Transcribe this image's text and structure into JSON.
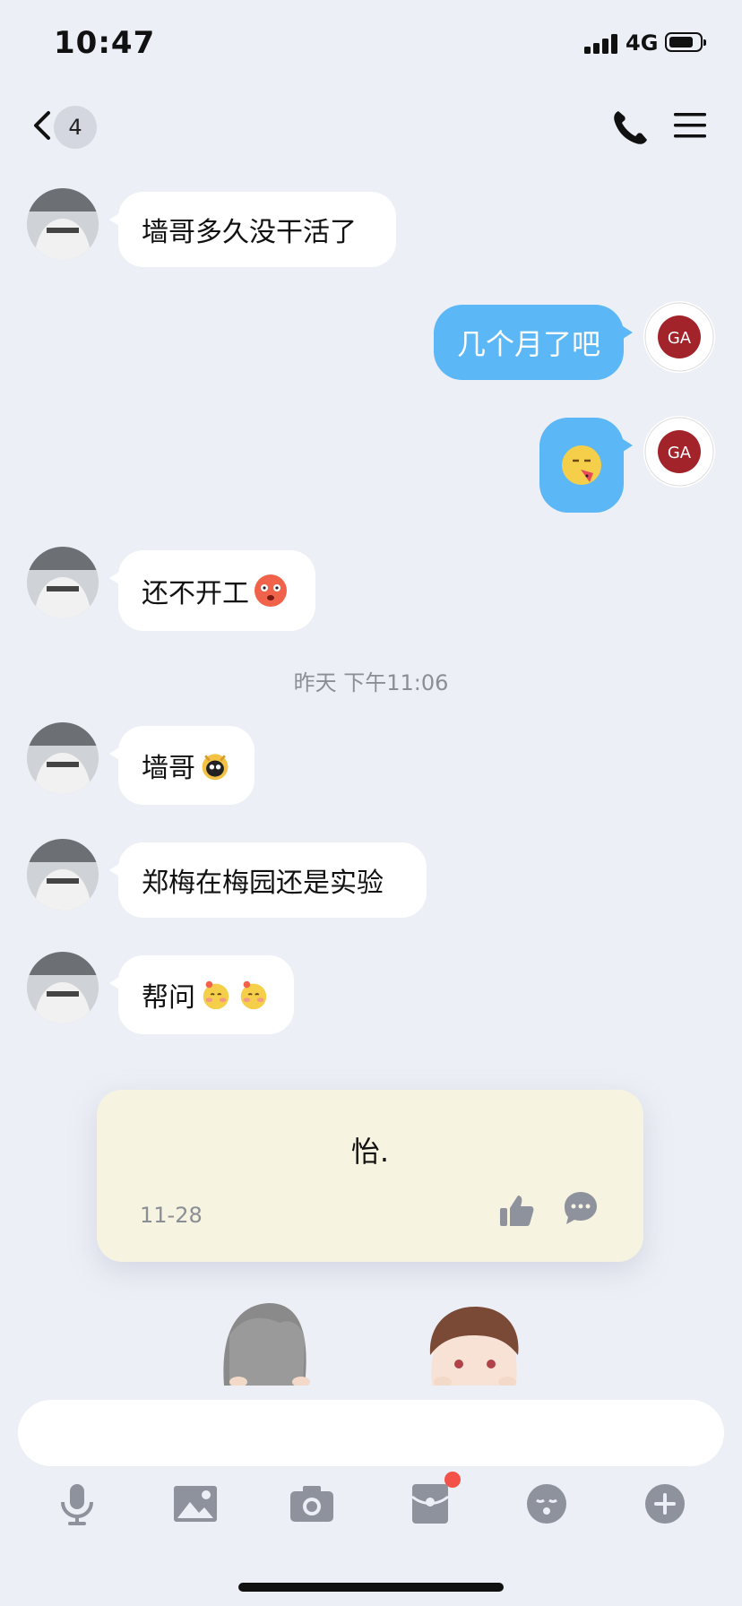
{
  "status_bar": {
    "time": "10:47",
    "network": "4G",
    "battery_fraction": 0.8
  },
  "nav": {
    "unread_badge": "4",
    "icons": [
      "back-chevron-icon",
      "phone-icon",
      "menu-icon"
    ]
  },
  "messages": [
    {
      "side": "in",
      "text": "墙哥多久没干活了",
      "emoji": []
    },
    {
      "side": "out",
      "text": "几个月了吧",
      "emoji": []
    },
    {
      "side": "out",
      "text": "",
      "emoji": [
        "eating-watermelon-emoji"
      ]
    },
    {
      "side": "in",
      "text": "还不开工",
      "emoji": [
        "angry-face-emoji"
      ]
    },
    {
      "side": "in",
      "text": "墙哥",
      "emoji": [
        "penguin-emoji"
      ]
    },
    {
      "side": "in",
      "text": "郑梅在梅园还是实验",
      "emoji": []
    },
    {
      "side": "in",
      "text": "帮问",
      "emoji": [
        "shy-face-emoji",
        "shy-face-emoji"
      ]
    }
  ],
  "timestamp": "昨天 下午11:06",
  "card": {
    "text": "怡.",
    "date": "11-28"
  },
  "toolbar": {
    "icons": [
      "mic-icon",
      "image-icon",
      "camera-icon",
      "red-packet-icon",
      "sticker-icon",
      "plus-icon"
    ],
    "red_packet_has_dot": true
  },
  "colors": {
    "bubble_out": "#5bb7f5",
    "background": "#eceff6",
    "card": "#f6f3e0"
  }
}
